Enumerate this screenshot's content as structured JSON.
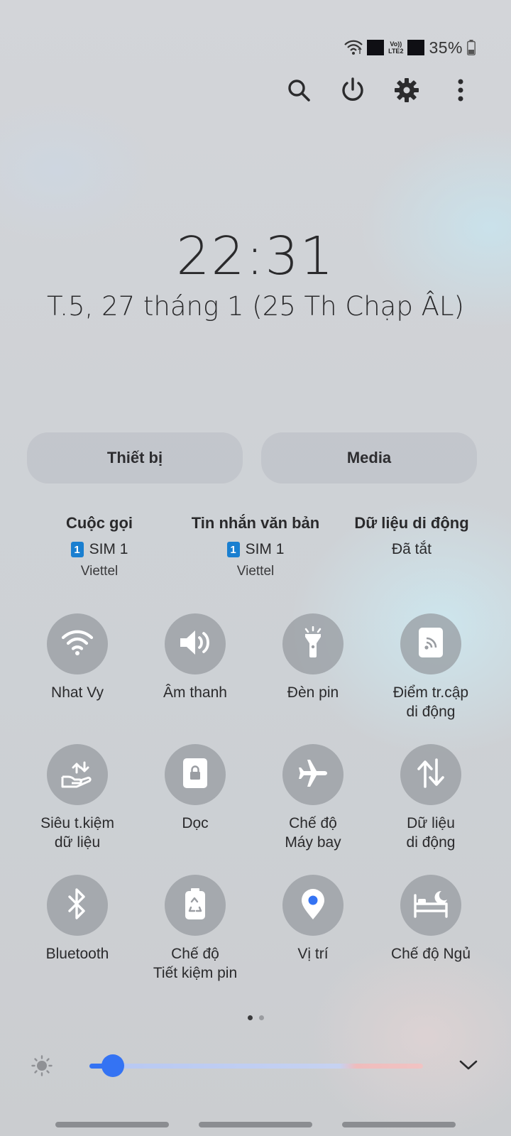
{
  "status": {
    "lte_line1": "Vo))",
    "lte_line2": "LTE2",
    "battery": "35%"
  },
  "icons": {
    "search": "search-icon",
    "power": "power-icon",
    "settings": "gear-icon",
    "more": "more-vertical-icon"
  },
  "clock": {
    "time": "22:31",
    "date": "T.5, 27 tháng 1 (25 Th Chạp ÂL)"
  },
  "tabs": {
    "device": "Thiết bị",
    "media": "Media"
  },
  "sim": [
    {
      "title": "Cuộc gọi",
      "badge": "1",
      "line": "SIM 1",
      "carrier": "Viettel"
    },
    {
      "title": "Tin nhắn văn bản",
      "badge": "1",
      "line": "SIM 1",
      "carrier": "Viettel"
    },
    {
      "title": "Dữ liệu di động",
      "line": "Đã tắt"
    }
  ],
  "tiles": [
    {
      "label": "Nhat Vy",
      "icon": "wifi-icon",
      "on": true
    },
    {
      "label": "Âm thanh",
      "icon": "volume-icon",
      "on": true
    },
    {
      "label": "Đèn pin",
      "icon": "flashlight-icon",
      "on": false
    },
    {
      "label": "Điểm tr.cập\ndi động",
      "icon": "hotspot-icon",
      "on": false
    },
    {
      "label": "Siêu t.kiệm\ndữ liệu",
      "icon": "data-saver-icon",
      "on": false
    },
    {
      "label": "Dọc",
      "icon": "portrait-lock-icon",
      "on": false
    },
    {
      "label": "Chế độ\nMáy bay",
      "icon": "airplane-icon",
      "on": false
    },
    {
      "label": "Dữ liệu\ndi động",
      "icon": "mobile-data-icon",
      "on": false
    },
    {
      "label": "Bluetooth",
      "icon": "bluetooth-icon",
      "on": false
    },
    {
      "label": "Chế độ\nTiết kiệm pin",
      "icon": "battery-saver-icon",
      "on": false
    },
    {
      "label": "Vị trí",
      "icon": "location-icon",
      "on": true
    },
    {
      "label": "Chế độ Ngủ",
      "icon": "sleep-mode-icon",
      "on": false
    }
  ],
  "brightness": {
    "level": 0.07,
    "icon": "brightness-icon"
  },
  "pages": {
    "count": 2,
    "current": 0
  },
  "colors": {
    "accent": "#3473f3",
    "tile_off": "#9a9da2",
    "text": "#2a2a2c"
  }
}
